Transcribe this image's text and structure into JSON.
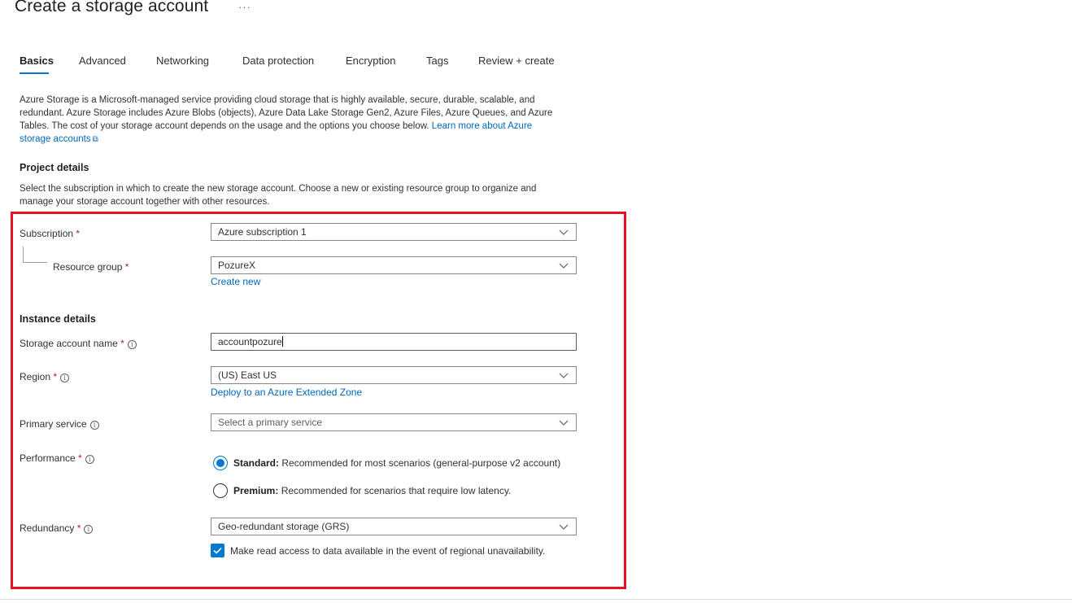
{
  "page": {
    "title": "Create a storage account",
    "more_label": "···"
  },
  "tabs": [
    {
      "label": "Basics"
    },
    {
      "label": "Advanced"
    },
    {
      "label": "Networking"
    },
    {
      "label": "Data protection"
    },
    {
      "label": "Encryption"
    },
    {
      "label": "Tags"
    },
    {
      "label": "Review + create"
    }
  ],
  "intro": {
    "line1": "Azure Storage is a Microsoft-managed service providing cloud storage that is highly available, secure, durable, scalable, and",
    "line2": "redundant. Azure Storage includes Azure Blobs (objects), Azure Data Lake Storage Gen2, Azure Files, Azure Queues, and Azure",
    "line3": "Tables. The cost of your storage account depends on the usage and the options you choose below.",
    "link_part1": "Learn more about Azure",
    "link_part2": "storage accounts"
  },
  "project": {
    "heading": "Project details",
    "desc_line1": "Select the subscription in which to create the new storage account. Choose a new or existing resource group to organize and",
    "desc_line2": "manage your storage account together with other resources."
  },
  "form": {
    "required_mark": "*",
    "subscription_label": "Subscription",
    "subscription_value": "Azure subscription 1",
    "resource_group_label": "Resource group",
    "resource_group_value": "PozureX",
    "create_new_link": "Create new",
    "instance_heading": "Instance details",
    "storage_name_label": "Storage account name",
    "storage_name_value": "accountpozure",
    "region_label": "Region",
    "region_value": "(US) East US",
    "extended_zone_link": "Deploy to an Azure Extended Zone",
    "primary_service_label": "Primary service",
    "primary_service_placeholder": "Select a primary service",
    "performance_label": "Performance",
    "standard_bold": "Standard:",
    "standard_text": "Recommended for most scenarios (general-purpose v2 account)",
    "premium_bold": "Premium:",
    "premium_text": "Recommended for scenarios that require low latency.",
    "redundancy_label": "Redundancy",
    "redundancy_value": "Geo-redundant storage (GRS)",
    "read_access_text": "Make read access to data available in the event of regional unavailability.",
    "read_access_checked": true,
    "performance_selected": "Standard"
  },
  "colors": {
    "accent": "#0078d4",
    "link": "#0067b8",
    "highlight_border": "#e81123",
    "required": "#a4262c"
  },
  "icons": {
    "more": "ellipsis-icon",
    "external": "external-link-icon",
    "info": "info-icon",
    "dropdown": "chevron-down-icon",
    "check": "checkmark-icon"
  }
}
